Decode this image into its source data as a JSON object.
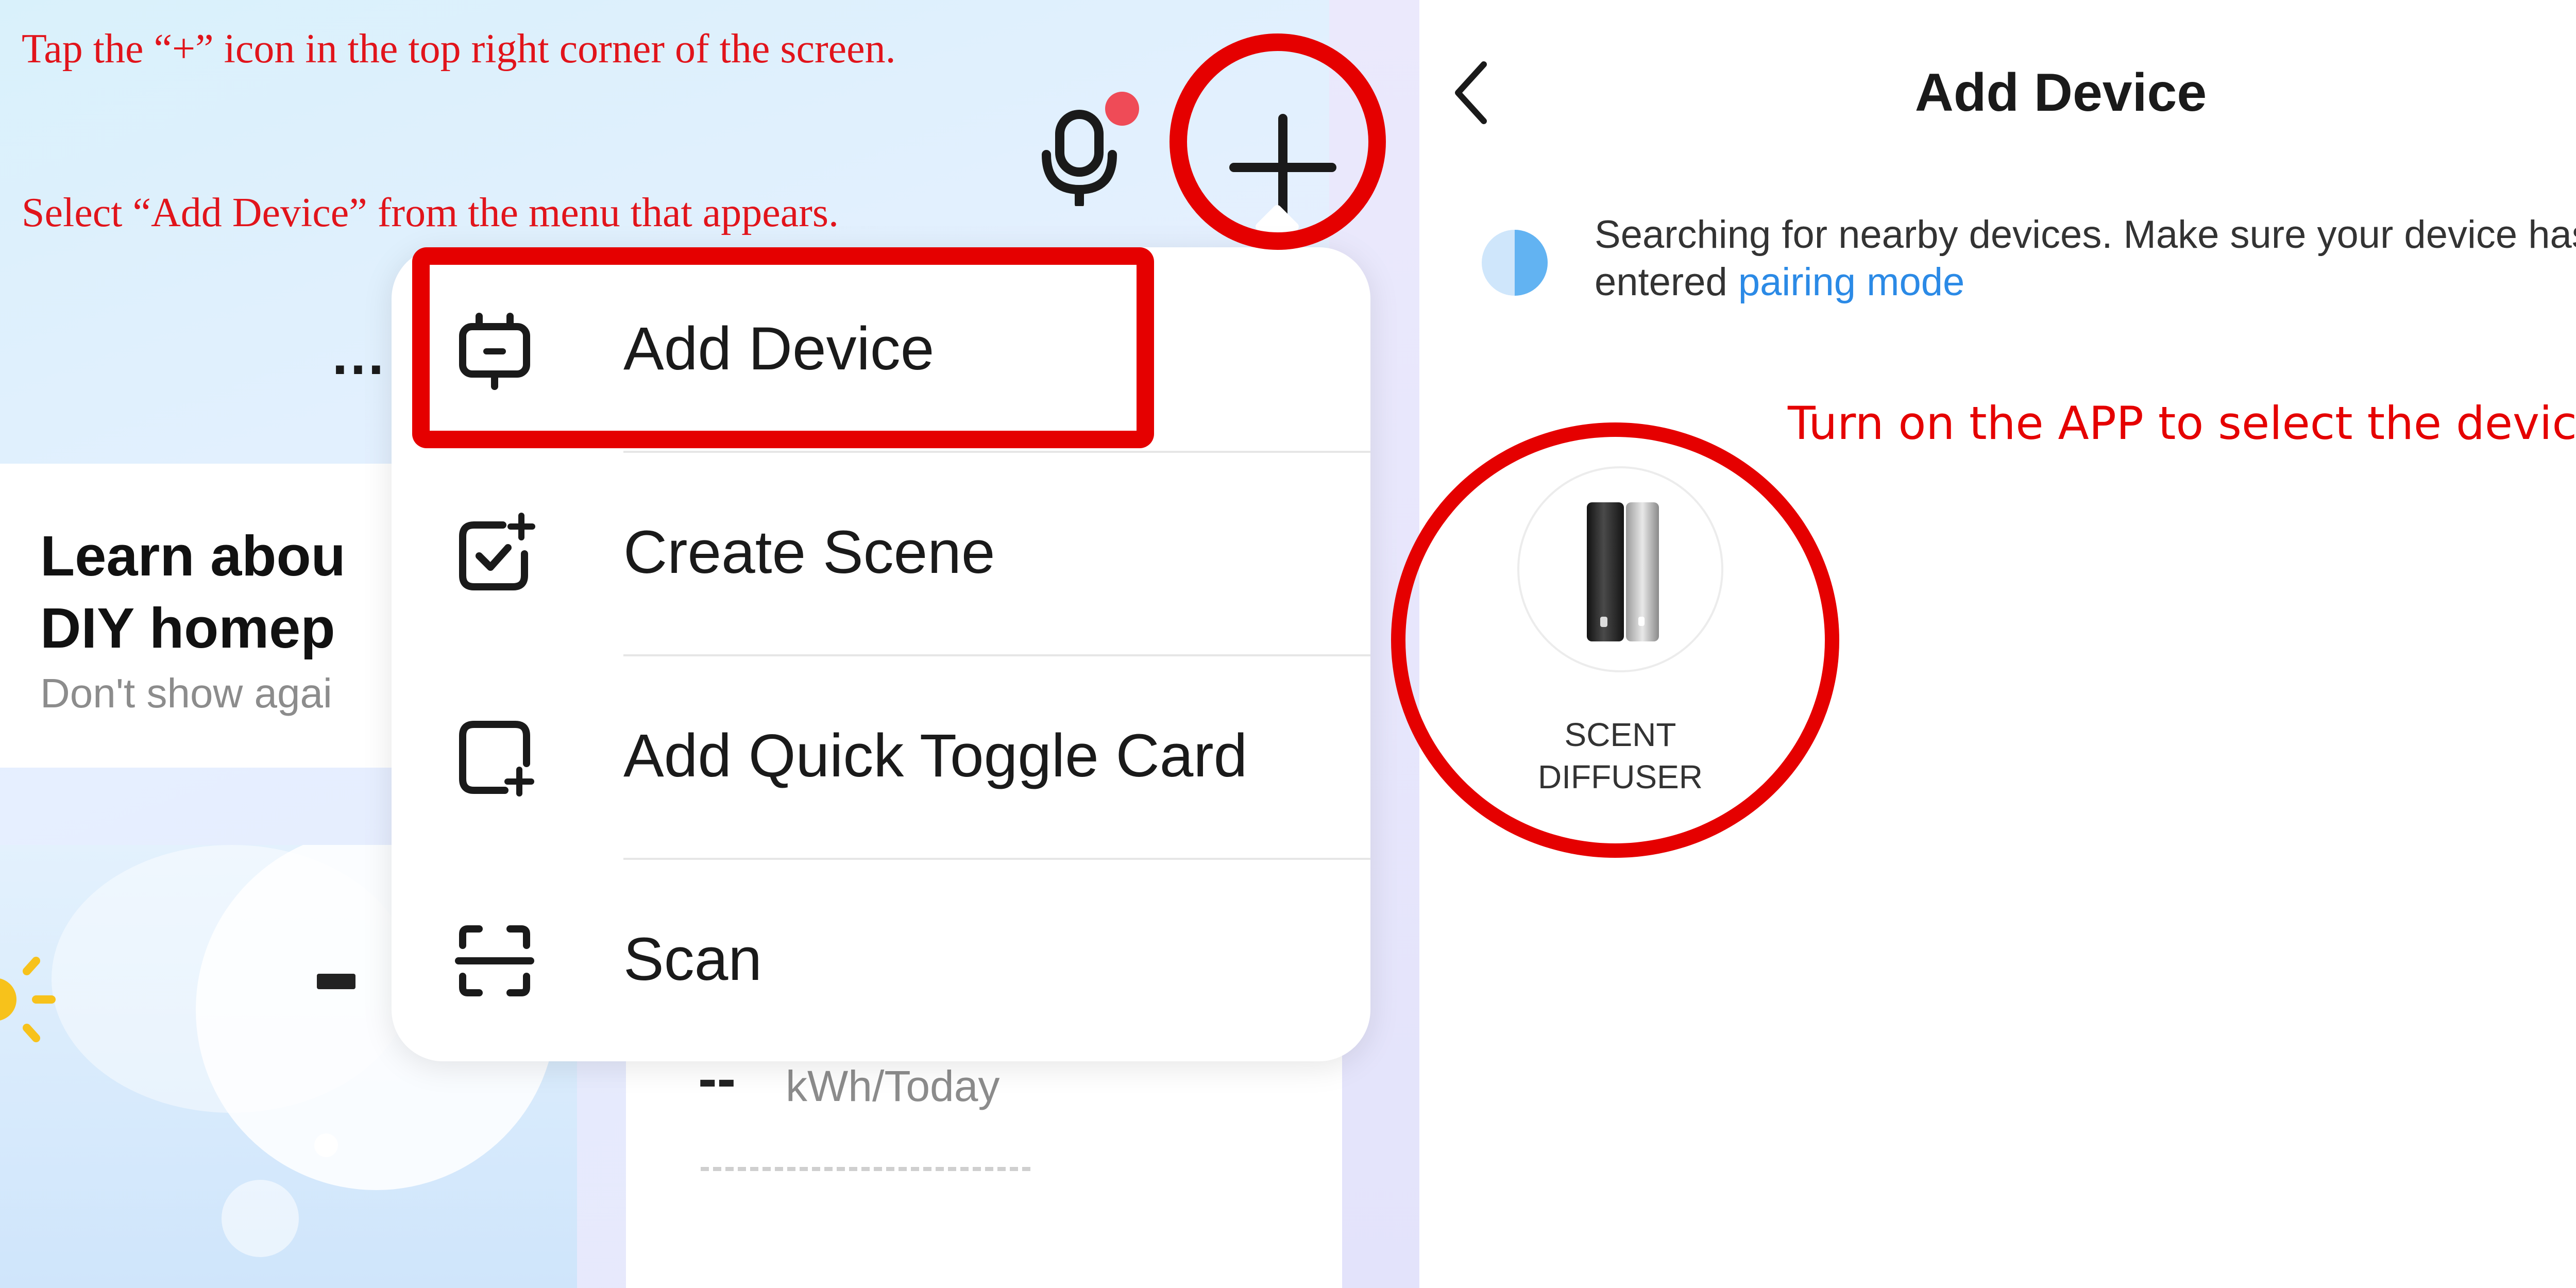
{
  "left": {
    "instruction_1": "Tap the “+” icon in the top right corner of the screen.",
    "instruction_2": "Select “Add Device” from the menu that appears.",
    "ellipsis": "…",
    "learn_card": {
      "title": "Learn abou\nDIY homep",
      "subtitle": "Don't show agai"
    },
    "energy": {
      "value": "--",
      "unit": "kWh/Today"
    },
    "menu": {
      "items": [
        {
          "label": "Add Device",
          "icon": "add-device-icon"
        },
        {
          "label": "Create Scene",
          "icon": "create-scene-icon"
        },
        {
          "label": "Add Quick Toggle Card",
          "icon": "quick-toggle-card-icon"
        },
        {
          "label": "Scan",
          "icon": "scan-icon"
        }
      ]
    },
    "colors": {
      "annotation_red": "#e50000",
      "badge_red": "#ef4b57"
    }
  },
  "right": {
    "header": {
      "title": "Add Device",
      "back_icon": "chevron-left-icon",
      "scan_icon": "scan-icon"
    },
    "search": {
      "text": "Searching for nearby devices. Make sure your device has entered ",
      "link": "pairing mode"
    },
    "annotation": "Turn on the APP to select the device.",
    "device": {
      "name": "SCENT DIFFUSER"
    },
    "colors": {
      "link_blue": "#2b8ae6"
    }
  }
}
